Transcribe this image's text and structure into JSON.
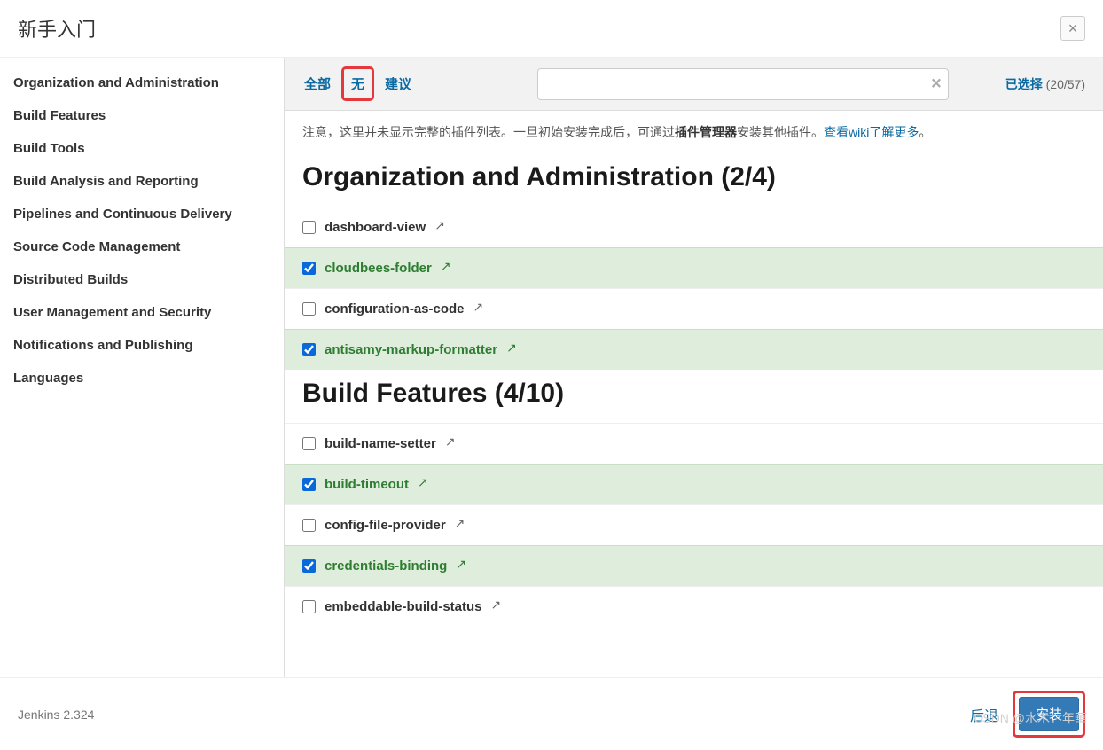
{
  "header": {
    "title": "新手入门",
    "close_label": "×"
  },
  "sidebar": {
    "items": [
      {
        "label": "Organization and Administration"
      },
      {
        "label": "Build Features"
      },
      {
        "label": "Build Tools"
      },
      {
        "label": "Build Analysis and Reporting"
      },
      {
        "label": "Pipelines and Continuous Delivery"
      },
      {
        "label": "Source Code Management"
      },
      {
        "label": "Distributed Builds"
      },
      {
        "label": "User Management and Security"
      },
      {
        "label": "Notifications and Publishing"
      },
      {
        "label": "Languages"
      }
    ]
  },
  "tabs": {
    "all": "全部",
    "none": "无",
    "suggested": "建议"
  },
  "search": {
    "placeholder": "",
    "clear": "×"
  },
  "selected": {
    "label": "已选择",
    "count": "(20/57)"
  },
  "notice": {
    "pre": "注意，这里并未显示完整的插件列表。一旦初始安装完成后，可通过",
    "bold": "插件管理器",
    "post": "安装其他插件。",
    "link": "查看wiki了解更多",
    "end": "。"
  },
  "sections": [
    {
      "title": "Organization and Administration (2/4)",
      "plugins": [
        {
          "name": "dashboard-view",
          "selected": false
        },
        {
          "name": "cloudbees-folder",
          "selected": true
        },
        {
          "name": "configuration-as-code",
          "selected": false
        },
        {
          "name": "antisamy-markup-formatter",
          "selected": true
        }
      ]
    },
    {
      "title": "Build Features (4/10)",
      "plugins": [
        {
          "name": "build-name-setter",
          "selected": false
        },
        {
          "name": "build-timeout",
          "selected": true
        },
        {
          "name": "config-file-provider",
          "selected": false
        },
        {
          "name": "credentials-binding",
          "selected": true
        },
        {
          "name": "embeddable-build-status",
          "selected": false
        }
      ]
    }
  ],
  "footer": {
    "version": "Jenkins 2.324",
    "back": "后退",
    "install": "安装"
  },
  "watermark": "CSDN @水木，年華"
}
